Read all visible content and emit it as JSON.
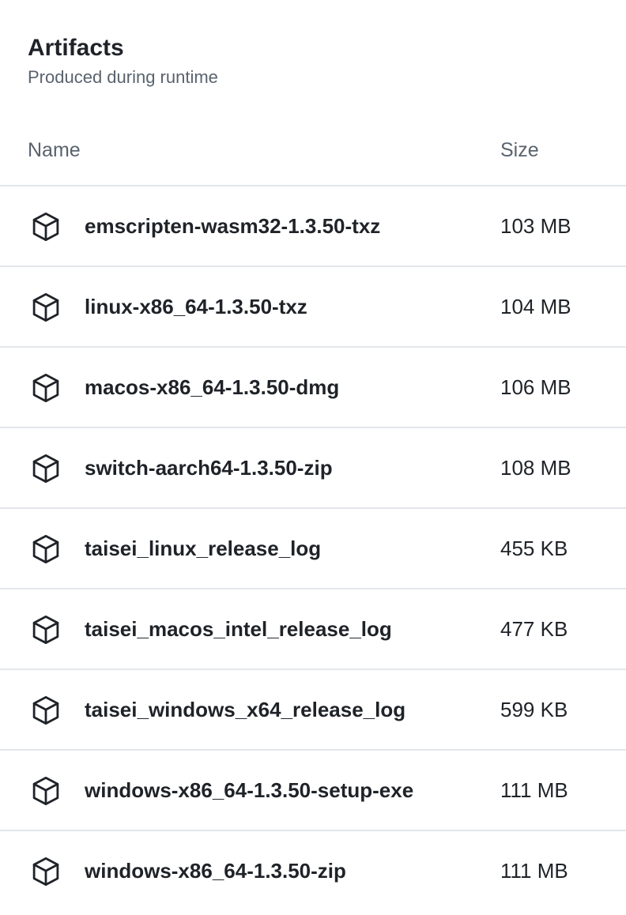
{
  "artifacts": {
    "title": "Artifacts",
    "subtitle": "Produced during runtime",
    "columns": {
      "name": "Name",
      "size": "Size"
    },
    "icon": "package-icon",
    "items": [
      {
        "name": "emscripten-wasm32-1.3.50-txz",
        "size": "103 MB"
      },
      {
        "name": "linux-x86_64-1.3.50-txz",
        "size": "104 MB"
      },
      {
        "name": "macos-x86_64-1.3.50-dmg",
        "size": "106 MB"
      },
      {
        "name": "switch-aarch64-1.3.50-zip",
        "size": "108 MB"
      },
      {
        "name": "taisei_linux_release_log",
        "size": "455 KB"
      },
      {
        "name": "taisei_macos_intel_release_log",
        "size": "477 KB"
      },
      {
        "name": "taisei_windows_x64_release_log",
        "size": "599 KB"
      },
      {
        "name": "windows-x86_64-1.3.50-setup-exe",
        "size": "111 MB"
      },
      {
        "name": "windows-x86_64-1.3.50-zip",
        "size": "111 MB"
      }
    ]
  }
}
